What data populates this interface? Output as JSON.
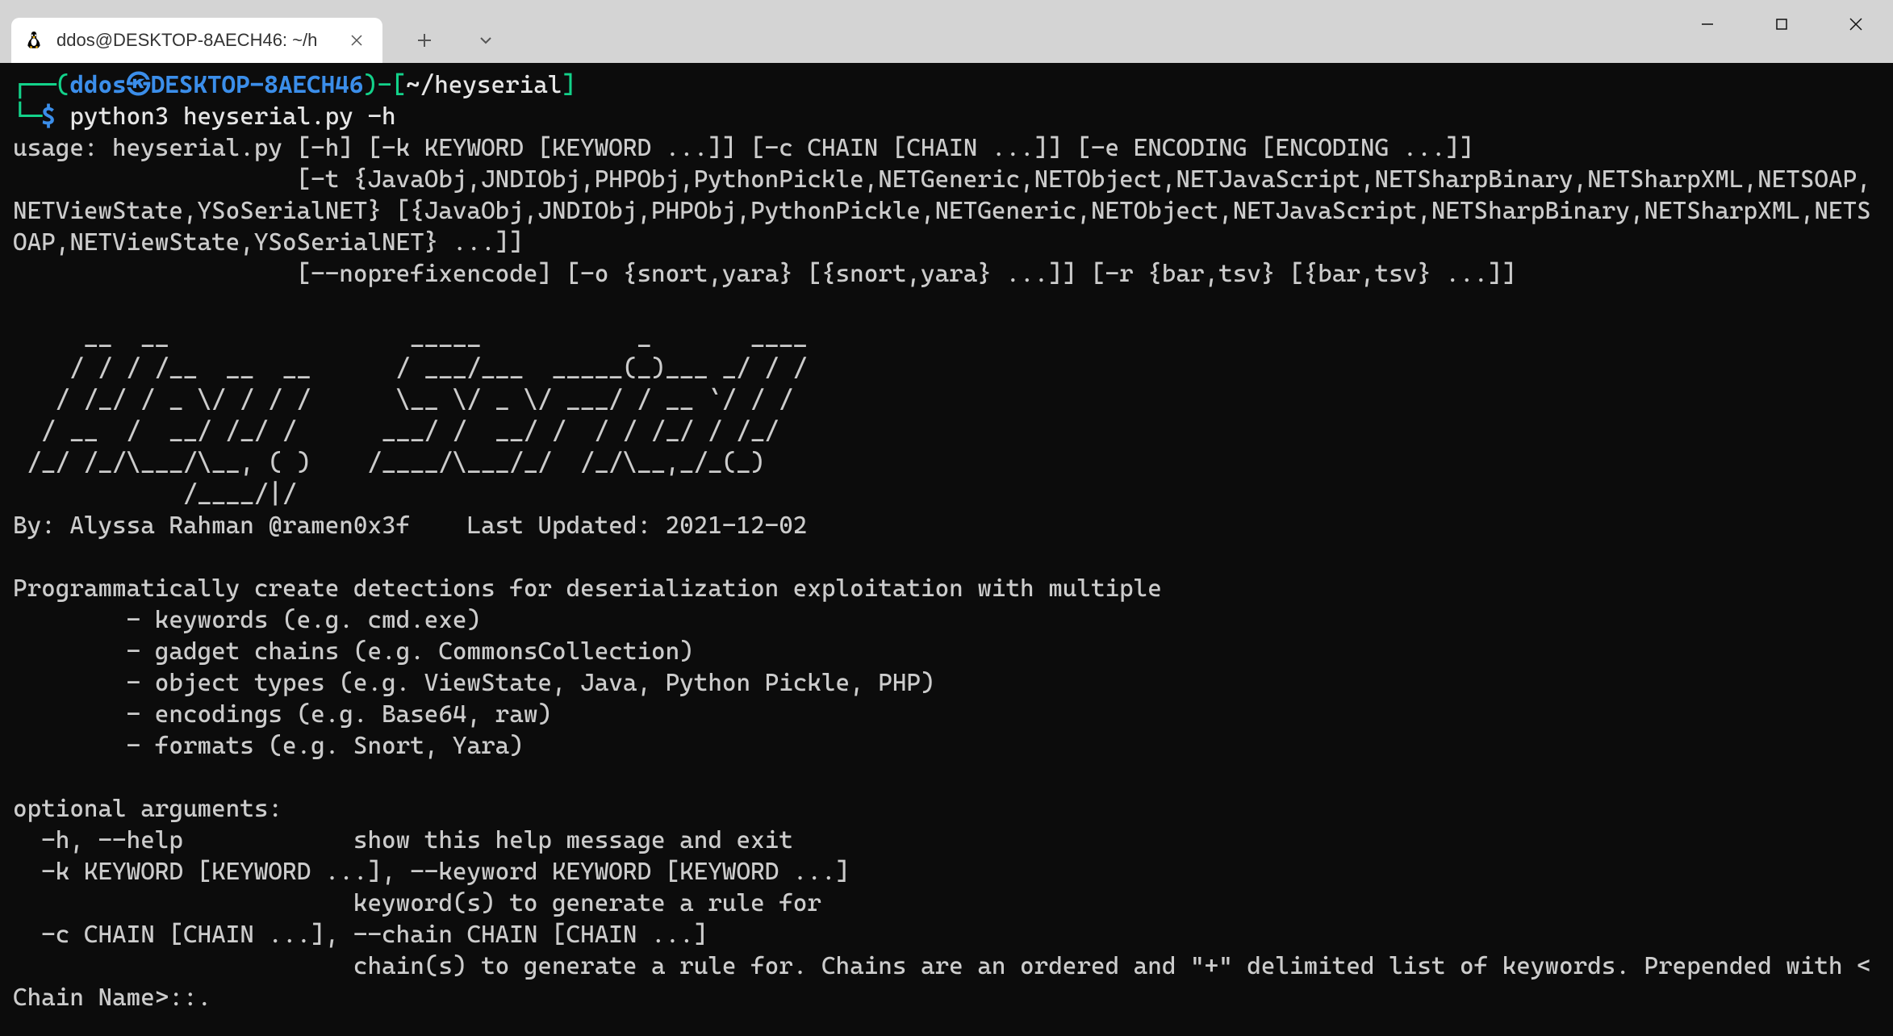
{
  "titlebar": {
    "tab_title": "ddos@DESKTOP-8AECH46: ~/h"
  },
  "prompt": {
    "open": "┌──(",
    "user": "ddos",
    "sep": "㉿",
    "host": "DESKTOP-8AECH46",
    "close": ")-[",
    "path": "~/heyserial",
    "end": "]",
    "line2_open": "└─",
    "dollar": "$ ",
    "command": "python3 heyserial.py -h"
  },
  "usage": "usage: heyserial.py [-h] [-k KEYWORD [KEYWORD ...]] [-c CHAIN [CHAIN ...]] [-e ENCODING [ENCODING ...]]\n                    [-t {JavaObj,JNDIObj,PHPObj,PythonPickle,NETGeneric,NETObject,NETJavaScript,NETSharpBinary,NETSharpXML,NETSOAP,NETViewState,YSoSerialNET} [{JavaObj,JNDIObj,PHPObj,PythonPickle,NETGeneric,NETObject,NETJavaScript,NETSharpBinary,NETSharpXML,NETSOAP,NETViewState,YSoSerialNET} ...]]\n                    [--noprefixencode] [-o {snort,yara} [{snort,yara} ...]] [-r {bar,tsv} [{bar,tsv} ...]]",
  "ascii": "     __  __                 _____           _       ____\n    / / / /__  __  __      / ___/___  _____(_)___ _/ / /\n   / /_/ / _ \\/ / / /      \\__ \\/ _ \\/ ___/ / __ `/ / /\n  / __  /  __/ /_/ /      ___/ /  __/ /  / / /_/ / /_/\n /_/ /_/\\___/\\__, ( )    /____/\\___/_/  /_/\\__,_/_(_)\n            /____/|/",
  "byline": "By: Alyssa Rahman @ramen0x3f    Last Updated: 2021-12-02",
  "desc_intro": "Programmatically create detections for deserialization exploitation with multiple",
  "desc_bullets": [
    "        - keywords (e.g. cmd.exe)",
    "        - gadget chains (e.g. CommonsCollection)",
    "        - object types (e.g. ViewState, Java, Python Pickle, PHP)",
    "        - encodings (e.g. Base64, raw)",
    "        - formats (e.g. Snort, Yara)"
  ],
  "opt_header": "optional arguments:",
  "opts": [
    "  -h, --help            show this help message and exit",
    "  -k KEYWORD [KEYWORD ...], --keyword KEYWORD [KEYWORD ...]",
    "                        keyword(s) to generate a rule for",
    "  -c CHAIN [CHAIN ...], --chain CHAIN [CHAIN ...]",
    "                        chain(s) to generate a rule for. Chains are an ordered and \"+\" delimited list of keywords. Prepended with <Chain Name>::."
  ]
}
